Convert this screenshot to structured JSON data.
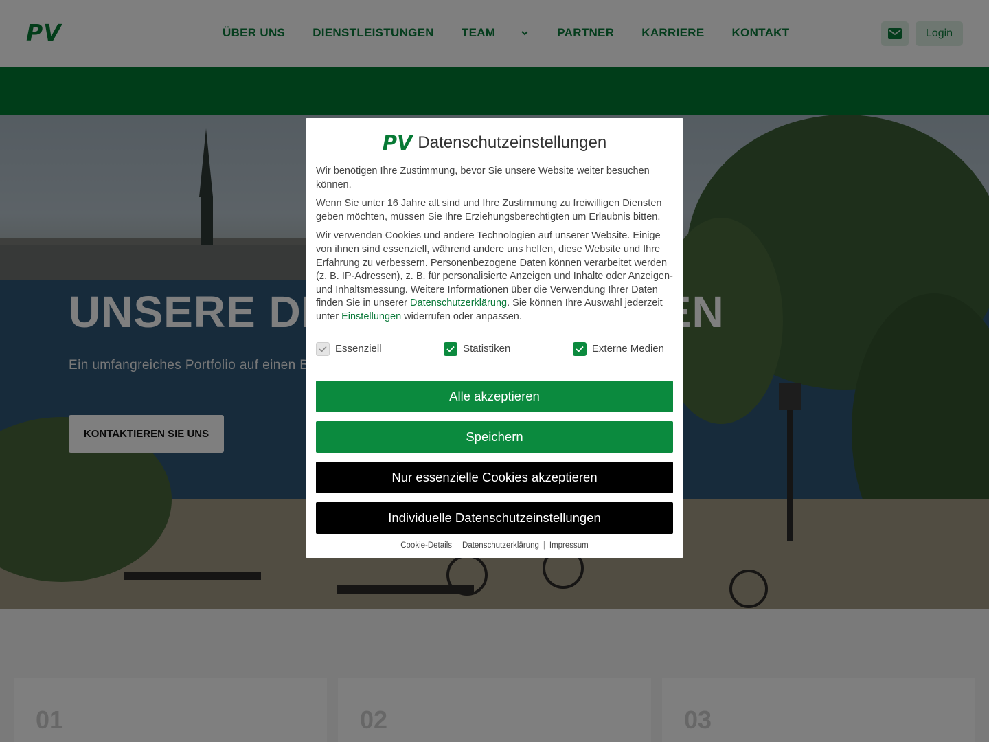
{
  "header": {
    "logo": "PV",
    "nav": [
      {
        "label": "ÜBER UNS"
      },
      {
        "label": "DIENSTLEISTUNGEN"
      },
      {
        "label": "TEAM"
      },
      {
        "label": "PARTNER"
      },
      {
        "label": "KARRIERE"
      },
      {
        "label": "KONTAKT"
      }
    ],
    "mail_icon": "mail-icon",
    "login_label": "Login"
  },
  "hero": {
    "title": "UNSERE DIENSTLEISTUNGEN",
    "subtitle": "Ein umfangreiches Portfolio auf einen Blick",
    "cta_label": "KONTAKTIEREN SIE UNS"
  },
  "cards": [
    {
      "number": "01"
    },
    {
      "number": "02"
    },
    {
      "number": "03"
    }
  ],
  "consent": {
    "logo": "PV",
    "title": "Datenschutzeinstellungen",
    "para1": "Wir benötigen Ihre Zustimmung, bevor Sie unsere Website weiter besuchen können.",
    "para2": "Wenn Sie unter 16 Jahre alt sind und Ihre Zustimmung zu freiwilligen Diensten geben möchten, müssen Sie Ihre Erziehungsberechtigten um Erlaubnis bitten.",
    "para3_a": "Wir verwenden Cookies und andere Technologien auf unserer Website. Einige von ihnen sind essenziell, während andere uns helfen, diese Website und Ihre Erfahrung zu verbessern. Personenbezogene Daten können verarbeitet werden (z. B. IP-Adressen), z. B. für personalisierte Anzeigen und Inhalte oder Anzeigen- und Inhaltsmessung. Weitere Informationen über die Verwendung Ihrer Daten finden Sie in unserer ",
    "para3_link1": "Datenschutzerklärung",
    "para3_b": ". Sie können Ihre Auswahl jederzeit unter ",
    "para3_link2": "Einstellungen",
    "para3_c": " widerrufen oder anpassen.",
    "checkboxes": [
      {
        "label": "Essenziell",
        "checked": true,
        "disabled": true
      },
      {
        "label": "Statistiken",
        "checked": true,
        "disabled": false
      },
      {
        "label": "Externe Medien",
        "checked": true,
        "disabled": false
      }
    ],
    "btn_accept_all": "Alle akzeptieren",
    "btn_save": "Speichern",
    "btn_essential": "Nur essenzielle Cookies akzeptieren",
    "btn_individual": "Individuelle Datenschutzeinstellungen",
    "footer_links": [
      "Cookie-Details",
      "Datenschutzerklärung",
      "Impressum"
    ],
    "colors": {
      "accent": "#0b8a3e",
      "dark": "#000000"
    }
  }
}
